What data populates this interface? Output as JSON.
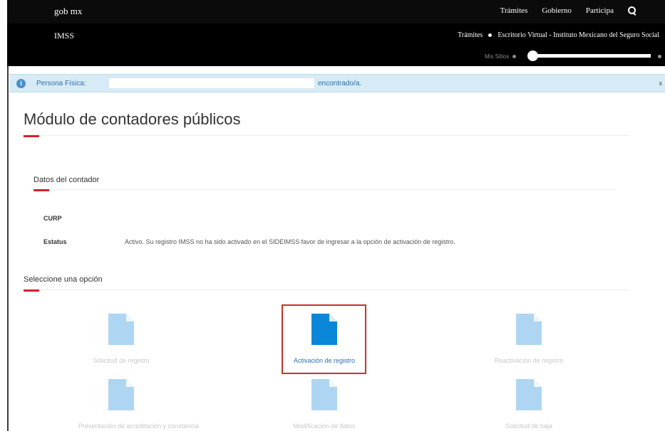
{
  "header": {
    "brand": "gob mx",
    "nav": [
      "Trámites",
      "Gobierno",
      "Participa"
    ],
    "search_icon": "search-icon"
  },
  "subheader": {
    "site_name": "IMSS",
    "breadcrumb": [
      "Trámites",
      "Escritorio Virtual - Instituto Mexicano del Seguro Social"
    ],
    "my_sites": "Mis Sitios"
  },
  "alert": {
    "label": "Persona Física:",
    "suffix": "encontrado/a.",
    "close": "x",
    "icon": "info-icon"
  },
  "page": {
    "title": "Módulo de contadores públicos"
  },
  "datos": {
    "heading": "Datos del contador",
    "fields": [
      {
        "label": "CURP",
        "value": ""
      },
      {
        "label": "Estatus",
        "value": "Activo. Su registro IMSS no ha sido activado en el SIDEIMSS favor de ingresar a la opción de activación de registro."
      }
    ]
  },
  "options": {
    "heading": "Seleccione una opción",
    "items": [
      {
        "label": "Solicitud de registro",
        "active": false
      },
      {
        "label": "Activación de registro",
        "active": true
      },
      {
        "label": "Reactivación de registro",
        "active": false
      },
      {
        "label": "Presentación de acreditación y constancia",
        "active": false
      },
      {
        "label": "Modificación de datos",
        "active": false
      },
      {
        "label": "Solicitud de baja",
        "active": false
      }
    ]
  },
  "colors": {
    "doc_inactive": "#aed6f2",
    "doc_active": "#0a87d8",
    "accent_red": "#d2232a"
  }
}
